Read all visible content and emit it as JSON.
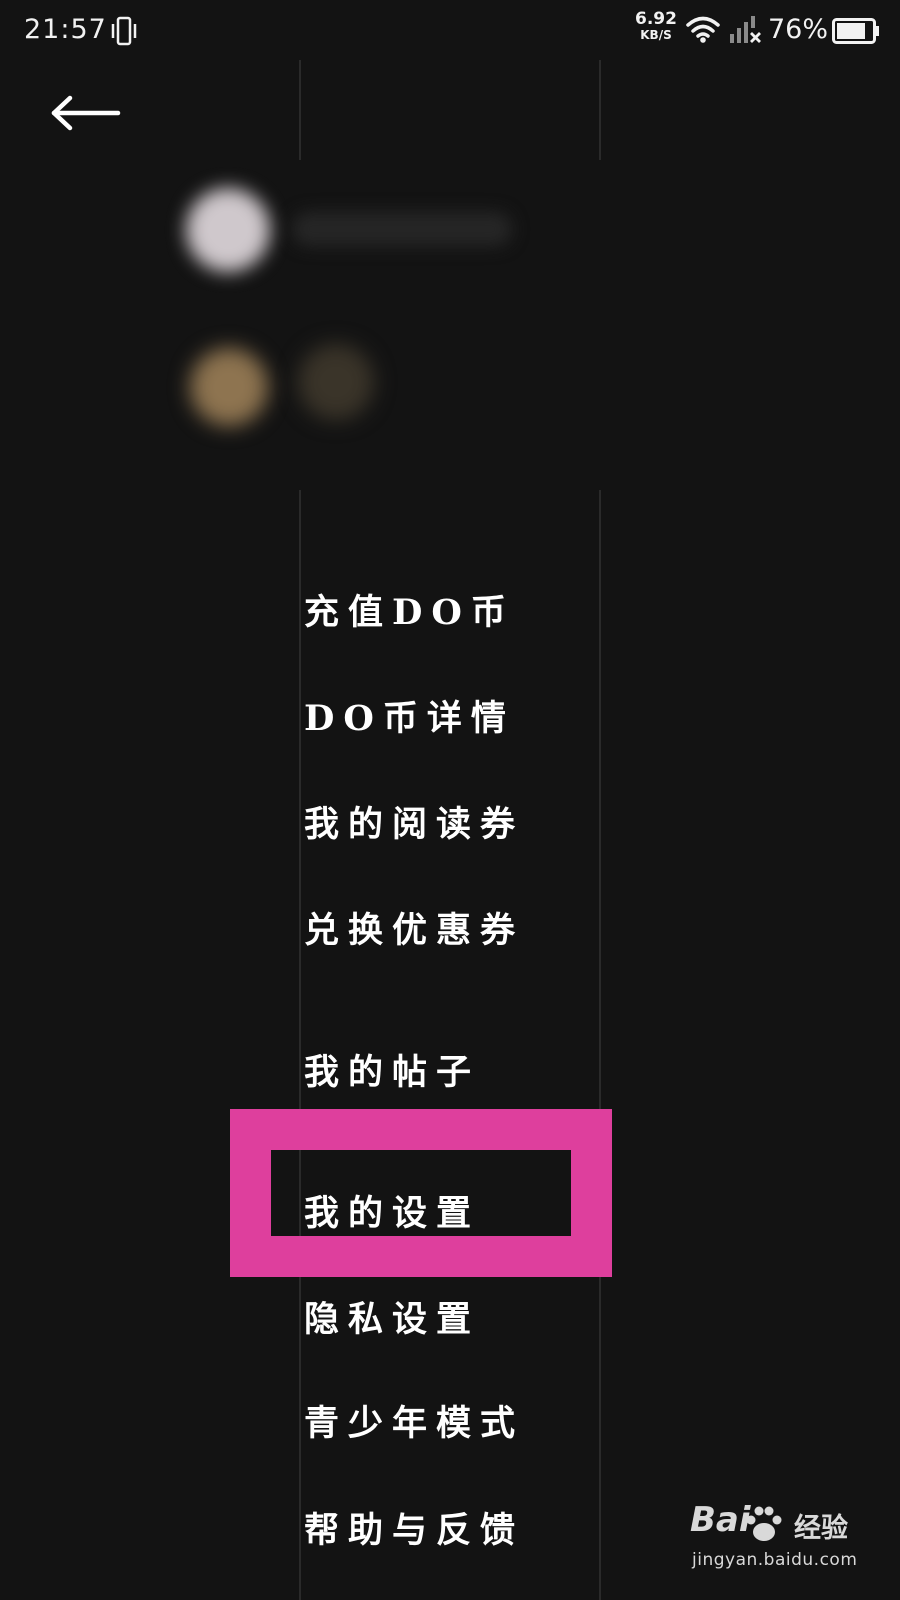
{
  "status_bar": {
    "time": "21:57",
    "net_speed_value": "6.92",
    "net_speed_unit": "KB/S",
    "battery_percent": "76%"
  },
  "menu": {
    "items": [
      {
        "label": "充值DO币"
      },
      {
        "label": "DO币详情"
      },
      {
        "label": "我的阅读券"
      },
      {
        "label": "兑换优惠券"
      },
      {
        "label": "我的帖子"
      },
      {
        "label": "我的设置"
      },
      {
        "label": "隐私设置"
      },
      {
        "label": "青少年模式"
      },
      {
        "label": "帮助与反馈"
      }
    ]
  },
  "watermark": {
    "brand": "Bai",
    "sub": "经验",
    "url": "jingyan.baidu.com"
  },
  "colors": {
    "background": "#131313",
    "highlight": "#de3f9d",
    "text": "#ffffff"
  }
}
